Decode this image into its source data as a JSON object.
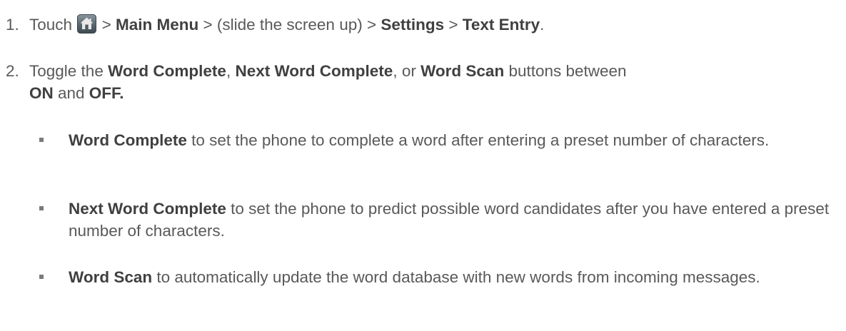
{
  "steps": [
    {
      "number": "1.",
      "t1": "Touch",
      "icon": "home-icon",
      "t2": " > ",
      "b1": "Main Menu",
      "t3": " > (slide the screen up) > ",
      "b2": "Settings",
      "t4": " > ",
      "b3": "Text Entry",
      "t5": "."
    },
    {
      "number": "2.",
      "t1": "Toggle the ",
      "b1": "Word Complete",
      "t2": ", ",
      "b2": "Next Word Complete",
      "t3": ", or ",
      "b3": "Word Scan",
      "t4": " buttons between ",
      "b4": "ON",
      "t5": " and ",
      "b5": "OFF."
    }
  ],
  "bullets": [
    {
      "bold": "Word Complete",
      "text": " to set the phone to complete a word after entering a preset number of characters."
    },
    {
      "bold": "Next Word Complete",
      "text": " to set the phone to predict possible word candidates after you have entered a preset number of characters."
    },
    {
      "bold": "Word Scan",
      "text": " to automatically update the word database with new words from incoming messages."
    }
  ],
  "colors": {
    "text": "#595959",
    "bold": "#404040",
    "icon_bg": "#5c6a72",
    "icon_fg": "#e9e9e9"
  }
}
